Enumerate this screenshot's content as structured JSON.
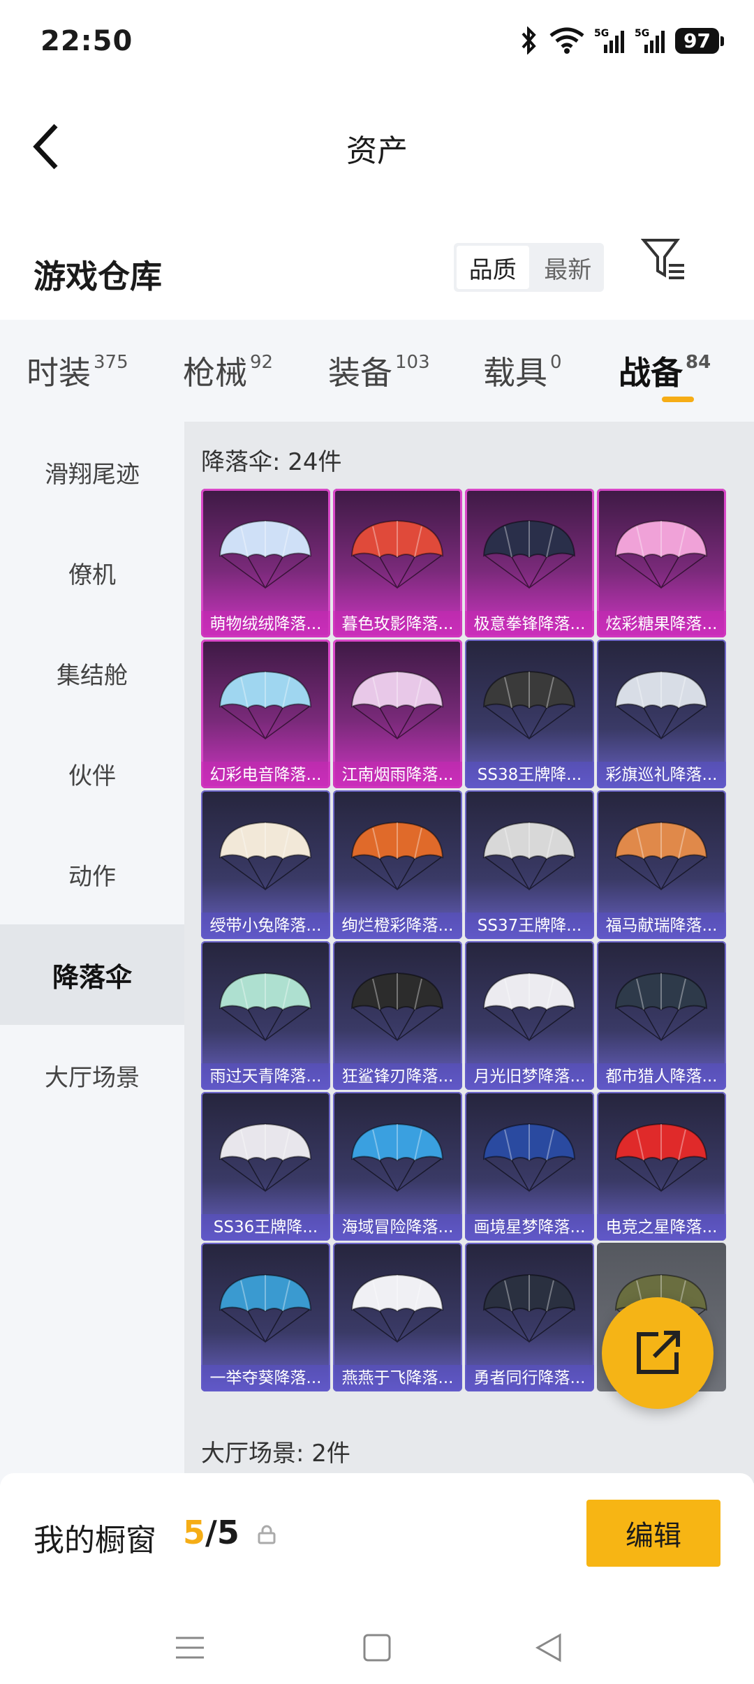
{
  "status_bar": {
    "time": "22:50",
    "battery": "97",
    "network": "5G"
  },
  "header": {
    "title": "资产",
    "back_icon": "chevron-left-icon"
  },
  "warehouse": {
    "title": "游戏仓库",
    "sort_options": [
      "品质",
      "最新"
    ],
    "sort_selected": "品质",
    "filter_icon": "filter-icon"
  },
  "tabs": [
    {
      "label": "时装",
      "count": "375"
    },
    {
      "label": "枪械",
      "count": "92"
    },
    {
      "label": "装备",
      "count": "103"
    },
    {
      "label": "载具",
      "count": "0"
    },
    {
      "label": "战备",
      "count": "84"
    }
  ],
  "active_tab": "战备",
  "sidebar": {
    "items": [
      "滑翔尾迹",
      "僚机",
      "集结舱",
      "伙伴",
      "动作",
      "降落伞",
      "大厅场景"
    ],
    "active": "降落伞"
  },
  "sections": {
    "parachute_title": "降落伞: 24件",
    "lobby_title": "大厅场景: 2件"
  },
  "items": [
    {
      "label": "萌物绒绒降落...",
      "rarity": "pink",
      "color": "#cfe0f7"
    },
    {
      "label": "暮色玫影降落...",
      "rarity": "pink",
      "color": "#e04a3a"
    },
    {
      "label": "极意拳锋降落...",
      "rarity": "pink",
      "color": "#2a2f4a"
    },
    {
      "label": "炫彩糖果降落...",
      "rarity": "pink",
      "color": "#f0a2d8"
    },
    {
      "label": "幻彩电音降落...",
      "rarity": "pink",
      "color": "#9fd6f0"
    },
    {
      "label": "江南烟雨降落...",
      "rarity": "pink",
      "color": "#e8c8e8"
    },
    {
      "label": "SS38王牌降...",
      "rarity": "blue",
      "color": "#3a3a3a"
    },
    {
      "label": "彩旗巡礼降落...",
      "rarity": "blue",
      "color": "#d8dde6"
    },
    {
      "label": "绶带小兔降落...",
      "rarity": "blue",
      "color": "#f2e8d8"
    },
    {
      "label": "绚烂橙彩降落...",
      "rarity": "blue",
      "color": "#e06a2a"
    },
    {
      "label": "SS37王牌降...",
      "rarity": "blue",
      "color": "#d8d8d8"
    },
    {
      "label": "福马献瑞降落...",
      "rarity": "blue",
      "color": "#e0894a"
    },
    {
      "label": "雨过天青降落...",
      "rarity": "blue",
      "color": "#aee0d0"
    },
    {
      "label": "狂鲨锋刃降落...",
      "rarity": "blue",
      "color": "#2c2c2c"
    },
    {
      "label": "月光旧梦降落...",
      "rarity": "blue",
      "color": "#ecebf0"
    },
    {
      "label": "都市猎人降落...",
      "rarity": "blue",
      "color": "#2e3a4a"
    },
    {
      "label": "SS36王牌降...",
      "rarity": "blue",
      "color": "#e8e6ec"
    },
    {
      "label": "海域冒险降落...",
      "rarity": "blue",
      "color": "#3aa0e0"
    },
    {
      "label": "画境星梦降落...",
      "rarity": "blue",
      "color": "#2a4aa0"
    },
    {
      "label": "电竞之星降落...",
      "rarity": "blue",
      "color": "#e02a2a"
    },
    {
      "label": "一举夺葵降落...",
      "rarity": "blue",
      "color": "#3a9ad0"
    },
    {
      "label": "燕燕于飞降落...",
      "rarity": "blue",
      "color": "#f0f0f4"
    },
    {
      "label": "勇者同行降落...",
      "rarity": "blue",
      "color": "#2a3040"
    },
    {
      "label": "",
      "rarity": "gray",
      "color": "#6a6e40"
    }
  ],
  "fab_icon": "share-external-icon",
  "showcase": {
    "label": "我的橱窗",
    "current": "5",
    "separator": "/",
    "total": "5",
    "lock_icon": "lock-icon"
  },
  "edit_button": "编辑",
  "navbar": {
    "menu_icon": "menu-icon",
    "home_icon": "square-home-icon",
    "back_icon": "triangle-back-icon"
  },
  "colors": {
    "accent": "#f5b416",
    "epic": "#d036c4",
    "rare": "#6a63c8"
  }
}
